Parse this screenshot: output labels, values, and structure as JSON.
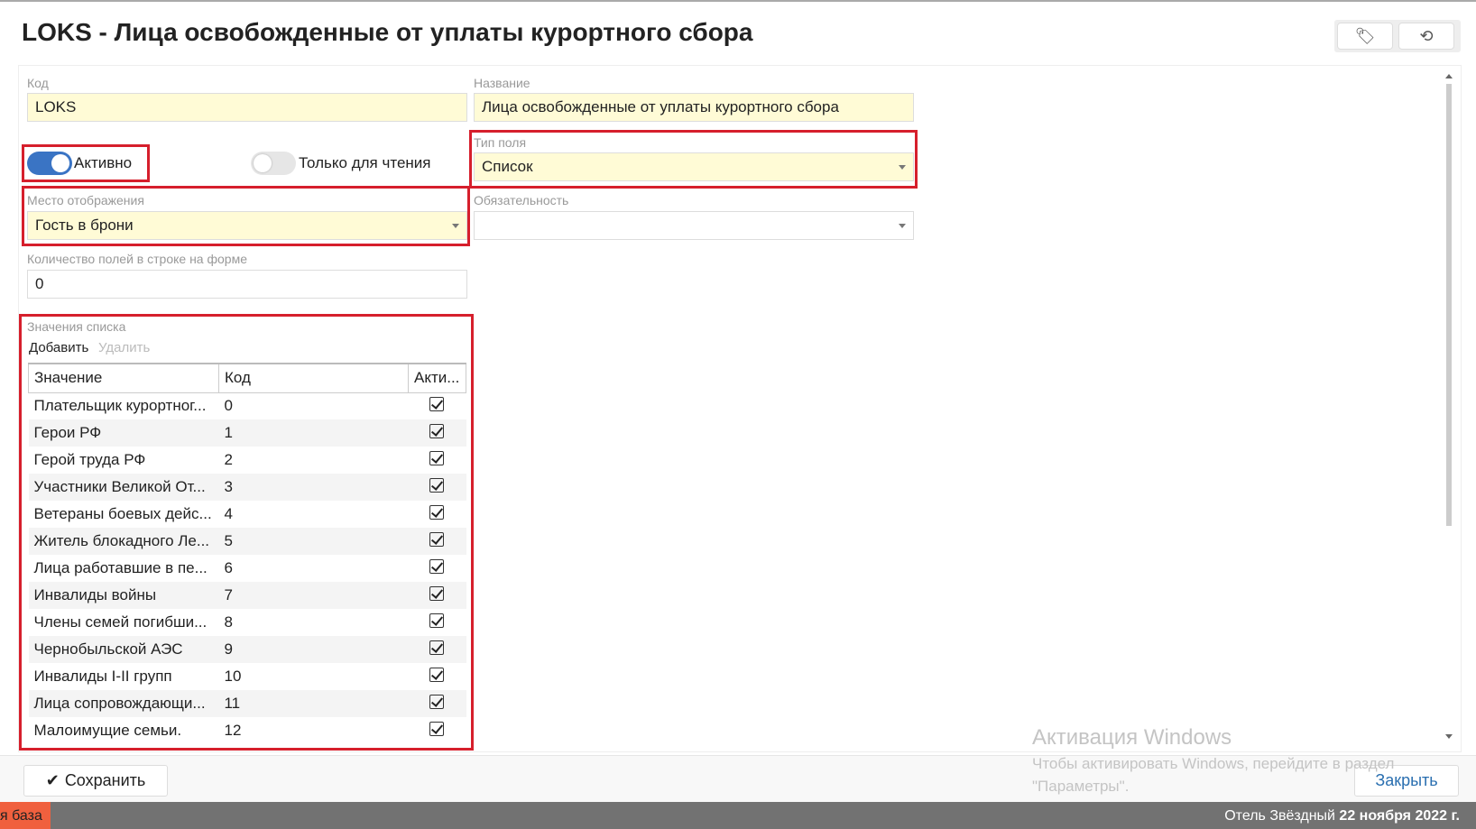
{
  "title": "LOKS - Лица освобожденные от уплаты курортного сбора",
  "toolbar": {
    "tags_icon": "tags-icon",
    "history_icon": "history-icon"
  },
  "form": {
    "code_label": "Код",
    "code_value": "LOKS",
    "name_label": "Название",
    "name_value": "Лица освобожденные от уплаты курортного сбора",
    "active_label": "Активно",
    "active": true,
    "readonly_label": "Только для чтения",
    "readonly": false,
    "field_type_label": "Тип поля",
    "field_type_value": "Список",
    "display_place_label": "Место отображения",
    "display_place_value": "Гость в брони",
    "required_label": "Обязательность",
    "required_value": "",
    "fields_per_row_label": "Количество полей в строке на форме",
    "fields_per_row_value": "0"
  },
  "list": {
    "label": "Значения списка",
    "add": "Добавить",
    "delete": "Удалить",
    "columns": [
      "Значение",
      "Код",
      "Акти..."
    ],
    "rows": [
      {
        "value": "Плательщик курортног...",
        "code": "0"
      },
      {
        "value": "Герои РФ",
        "code": "1"
      },
      {
        "value": "Герой труда РФ",
        "code": "2"
      },
      {
        "value": "Участники Великой От...",
        "code": "3"
      },
      {
        "value": "Ветераны боевых дейс...",
        "code": "4"
      },
      {
        "value": "Житель блокадного Ле...",
        "code": "5"
      },
      {
        "value": "Лица работавшие в пе...",
        "code": "6"
      },
      {
        "value": "Инвалиды войны",
        "code": "7"
      },
      {
        "value": "Члены семей погибши...",
        "code": "8"
      },
      {
        "value": "Чернобыльской АЭС",
        "code": "9"
      },
      {
        "value": "Инвалиды I-II групп",
        "code": "10"
      },
      {
        "value": "Лица сопровождающи...",
        "code": "11"
      },
      {
        "value": "Малоимущие семьи.",
        "code": "12"
      }
    ]
  },
  "footer": {
    "save": "Сохранить",
    "close": "Закрыть"
  },
  "watermark": {
    "title": "Активация Windows",
    "text1": "Чтобы активировать Windows, перейдите в раздел",
    "text2": "\"Параметры\"."
  },
  "status": {
    "badge": "я база",
    "hotel": "Отель Звёздный",
    "date": "22 ноября 2022 г."
  },
  "colors": {
    "accent": "#3a74c4",
    "highlight": "#d61f2c",
    "input_bg": "#fffbd6",
    "status_bg": "#727272",
    "badge": "#f0603e"
  }
}
